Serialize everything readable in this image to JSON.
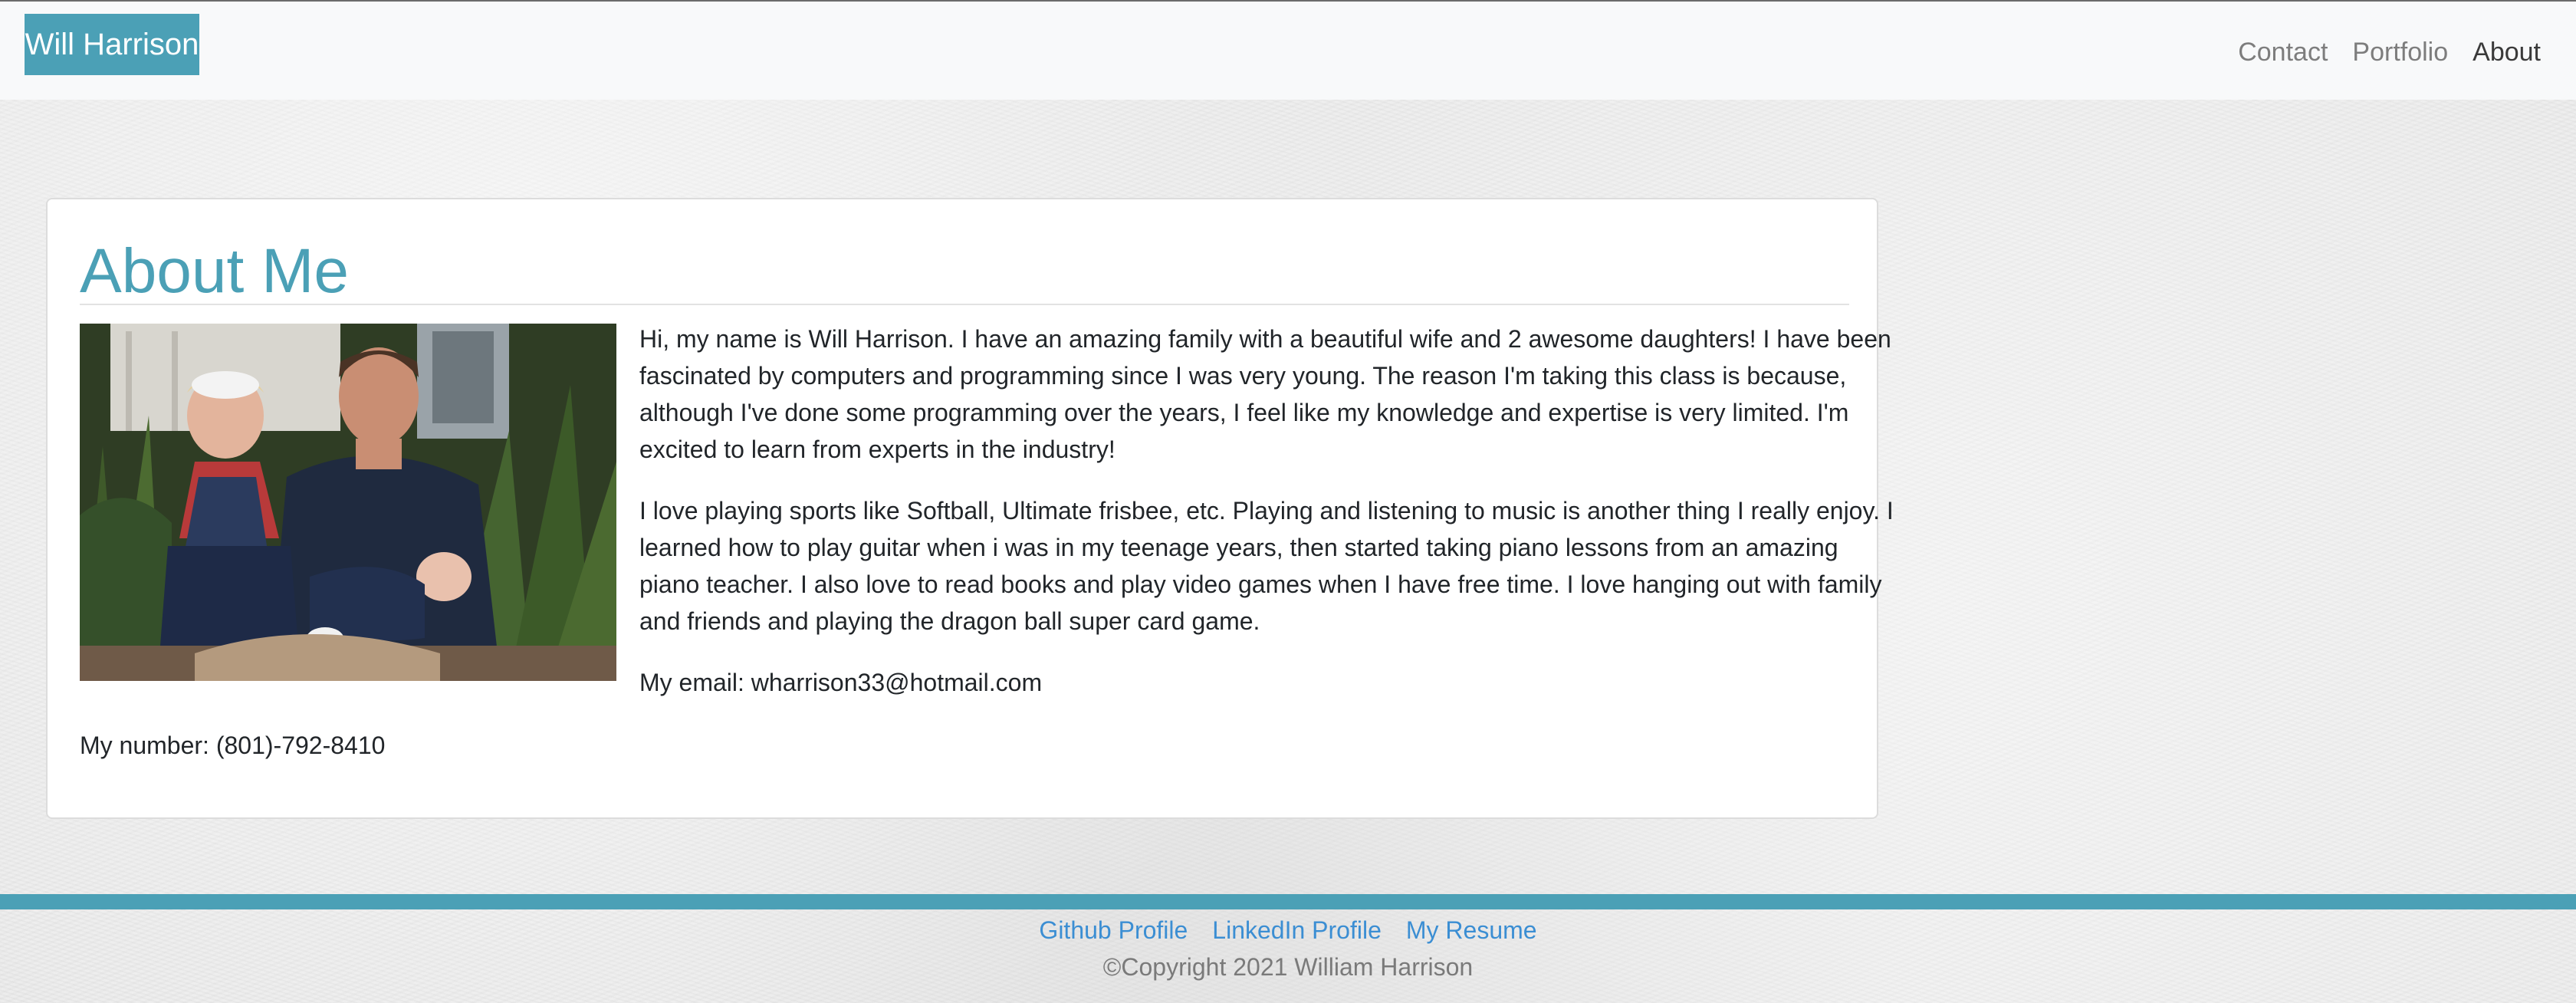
{
  "navbar": {
    "brand": "Will Harrison",
    "links": [
      "Contact",
      "Portfolio",
      "About"
    ],
    "active": "About"
  },
  "about": {
    "title": "About Me",
    "paragraphs": [
      "Hi, my name is Will Harrison. I have an amazing family with a beautiful wife and 2 awesome daughters! I have been fascinated by computers and programming since I was very young. The reason I'm taking this class is because, although I've done some programming over the years, I feel like my knowledge and expertise is very limited. I'm excited to learn from experts in the industry!",
      "I love playing sports like Softball, Ultimate frisbee, etc. Playing and listening to music is another thing I really enjoy. I learned how to play guitar when i was in my teenage years, then started taking piano lessons from an amazing piano teacher. I also love to read books and play video games when I have free time. I love hanging out with family and friends and playing the dragon ball super card game."
    ],
    "email": "My email: wharrison33@hotmail.com",
    "number": "My number: (801)-792-8410"
  },
  "footer": {
    "links": [
      "Github Profile",
      "LinkedIn Profile",
      "My Resume"
    ],
    "copyright": "©Copyright 2021 William Harrison"
  },
  "colors": {
    "accent": "#4ba0b6",
    "link": "#3b8ed3",
    "navbar_bg": "#f8f9fa",
    "text": "#212529"
  },
  "icons": {
    "photo": "family-photo"
  }
}
